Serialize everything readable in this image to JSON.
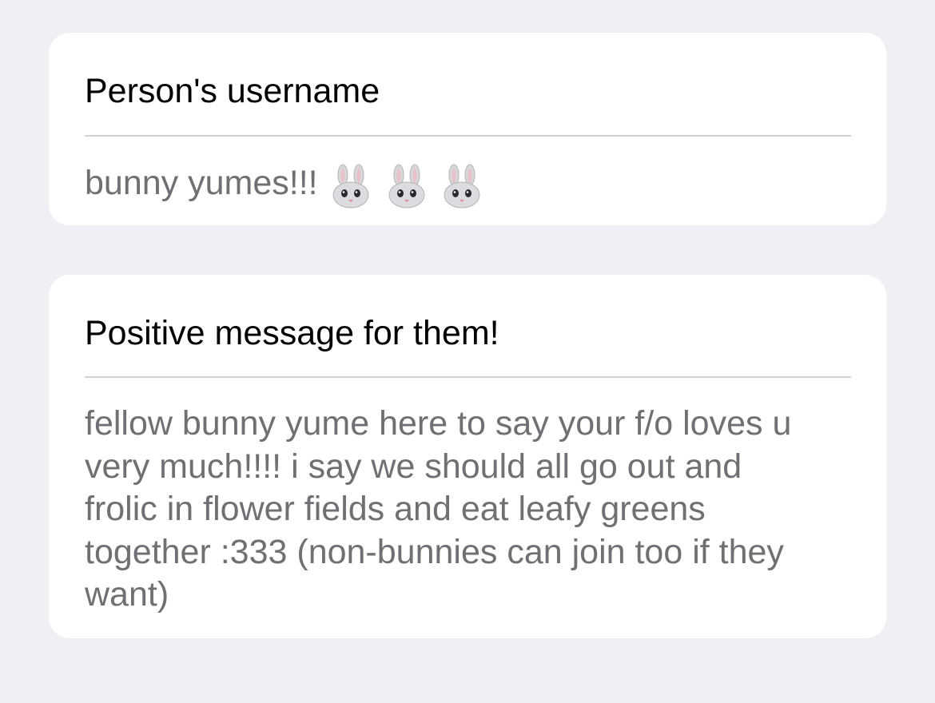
{
  "username_field": {
    "label": "Person's username",
    "value": "bunny yumes!!!",
    "emoji": [
      "rabbit-face-icon",
      "rabbit-face-icon",
      "rabbit-face-icon"
    ]
  },
  "message_field": {
    "label": "Positive message for them!",
    "value": "fellow bunny yume here to say your f/o loves u\nvery much!!!! i say we should all go out and\nfrolic  in flower fields and eat leafy greens\ntogether :333 (non-bunnies can join too if they\nwant)"
  },
  "colors": {
    "background": "#efeff4",
    "card": "#ffffff",
    "label_text": "#000000",
    "value_text": "#6f6f74",
    "divider": "#d2d2d6"
  }
}
